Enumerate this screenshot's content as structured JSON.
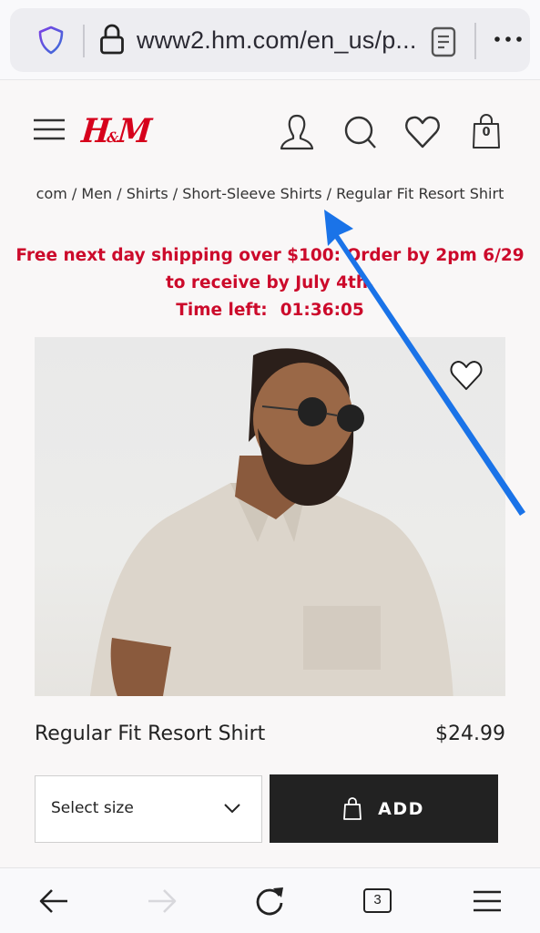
{
  "browser": {
    "url_display": "www2.hm.com/en_us/p...",
    "icons": {
      "tracking_protection": "shield-icon",
      "security": "lock-icon",
      "reader_mode": "reader-view-icon",
      "menu": "more-horizontal-icon"
    },
    "toolbar": {
      "back": "arrow-left-icon",
      "forward": "arrow-right-icon",
      "reload": "reload-icon",
      "tab_count": "3",
      "menu": "hamburger-icon"
    }
  },
  "site": {
    "brand": {
      "logo_text_h": "H",
      "logo_text_amp": "&",
      "logo_text_m": "M",
      "color": "#d6001c"
    },
    "header_icons": [
      "account-icon",
      "search-icon",
      "favorites-icon",
      "shopping-bag-icon"
    ],
    "cart_count": "0"
  },
  "breadcrumb": {
    "items": [
      "com",
      "Men",
      "Shirts",
      "Short-Sleeve Shirts",
      "Regular Fit Resort Shirt"
    ],
    "separator": " / "
  },
  "promo": {
    "line1": "Free next day shipping over $100: Order by 2pm 6/29",
    "line2": "to receive by July 4th.",
    "timer_label": "Time left:",
    "timer_value": "01:36:05",
    "color": "#cc0a2b"
  },
  "product": {
    "image_alt": "Model wearing beige Regular Fit Resort Shirt and round sunglasses",
    "name": "Regular Fit Resort Shirt",
    "price": "$24.99",
    "size_select": {
      "placeholder": "Select size"
    },
    "add_button_label": "ADD"
  },
  "annotation": {
    "type": "arrow",
    "color": "#1a73e8",
    "points_to": "breadcrumb"
  }
}
